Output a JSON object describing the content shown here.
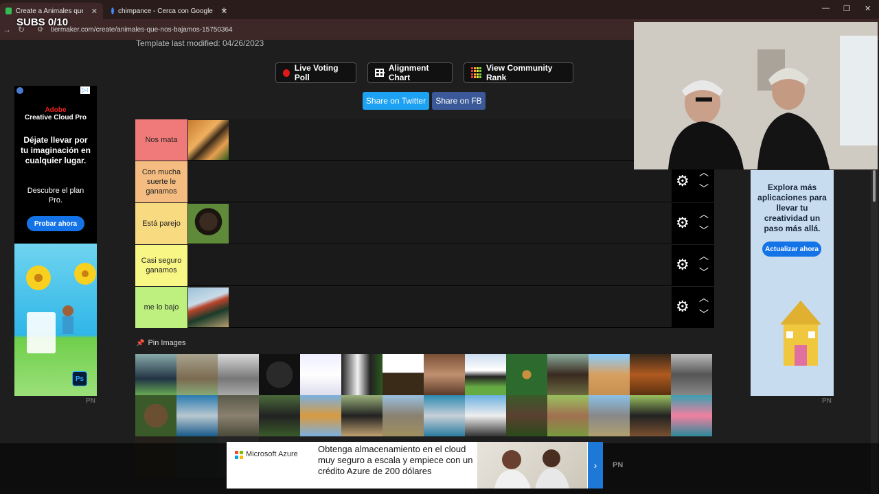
{
  "overlay": {
    "subs": "SUBS 0/10"
  },
  "browser": {
    "tabs": [
      {
        "title": "Create a Animales que nos baja",
        "active": true
      },
      {
        "title": "chimpance - Cerca con Google",
        "active": false
      }
    ],
    "url": "tiermaker.com/create/animales-que-nos-bajamos-15750364"
  },
  "page": {
    "template_modified": "Template last modified: 04/26/2023",
    "actions": {
      "live_poll": "Live Voting Poll",
      "alignment": "Alignment Chart",
      "community": "View Community Rank"
    },
    "share": {
      "twitter": "Share on Twitter",
      "fb": "Share on FB"
    },
    "tiers": [
      {
        "label": "Nos mata",
        "color": "#f07a7a",
        "image": "tiger"
      },
      {
        "label": "Con mucha suerte le ganamos",
        "color": "#f4bc80",
        "image": ""
      },
      {
        "label": "Está parejo",
        "color": "#f8da80",
        "image": "chimpanzee"
      },
      {
        "label": "Casi seguro ganamos",
        "color": "#f8f684",
        "image": ""
      },
      {
        "label": "me lo bajo",
        "color": "#bef080",
        "image": "rooster"
      }
    ],
    "pin_images": "Pin Images"
  },
  "ads": {
    "left": {
      "brand": "Adobe",
      "product": "Creative Cloud Pro",
      "headline": "Déjate llevar por tu imaginación en cualquier lugar.",
      "sub": "Descubre el plan Pro.",
      "cta": "Probar ahora",
      "badge": "Ps",
      "tag": "PN"
    },
    "right": {
      "headline": "Explora más aplicaciones para llevar tu creatividad un paso más allá.",
      "cta": "Actualizar ahora",
      "tag": "PN"
    },
    "bottom": {
      "brand": "Microsoft Azure",
      "text": "Obtenga almacenamiento en el cloud muy seguro a escala y empiece con un crédito Azure de 200 dólares",
      "tag": "PN"
    }
  }
}
